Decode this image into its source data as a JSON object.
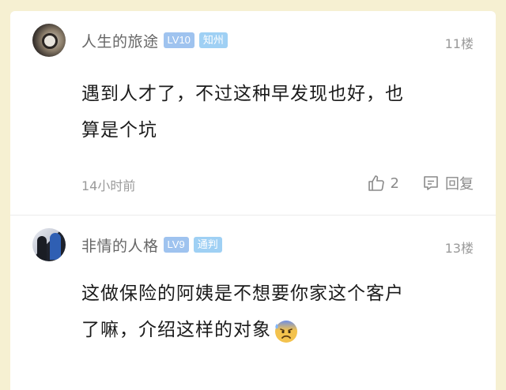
{
  "posts": [
    {
      "username": "人生的旅途",
      "level": "LV10",
      "location": "知州",
      "floor": "11楼",
      "lines": [
        "遇到人才了，不过这种早发现也好，也",
        "算是个坑"
      ],
      "time": "14小时前",
      "likes": "2",
      "reply_label": "回复",
      "avatar_icon": "watch-avatar"
    },
    {
      "username": "非情的人格",
      "level": "LV9",
      "location": "通判",
      "floor": "13楼",
      "lines": [
        "这做保险的阿姨是不想要你家这个客户",
        "了嘛，介绍这样的对象"
      ],
      "emoji": "anxious-sweat-face-emoji",
      "avatar_icon": "couple-photo-avatar"
    }
  ],
  "colors": {
    "background": "#f6f0d2",
    "card": "#ffffff",
    "badge_level": "#9fc3ef",
    "badge_location": "#9fd0f4"
  }
}
